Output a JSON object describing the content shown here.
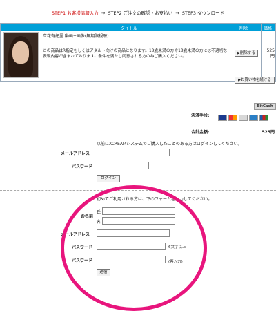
{
  "steps": {
    "step1": "STEP1 お客様情報入力",
    "arrow": "→",
    "step2": "STEP2 ご注文の確認・お支払い",
    "step3": "STEP3 ダウンロード"
  },
  "cart": {
    "col_title": "タイトル",
    "col_delete": "削除",
    "col_price": "価格",
    "item_title": "立花有紀里 動画+画像(無期限視聴)",
    "item_notice": "この商品はR指定もしくはアダルト向けの商品となります。18歳未満の方や18歳未満の方には不適切な表現内容が含まれております。条件を満たし同意される方のみご購入ください。",
    "delete_label": "削除する",
    "price": "525",
    "price_unit": "円",
    "continue_label": "お買い物を続ける"
  },
  "payment": {
    "bitcash_label": "BitCash",
    "method_label": "決済手段:",
    "cards": [
      "VISA",
      "MasterCard",
      "DC",
      "AMEX",
      "JCB"
    ],
    "total_label": "合計金額:",
    "total_value": "525円"
  },
  "login": {
    "note": "以前にXCREAMシステムでご購入したことのある方はログインしてください。",
    "email_label": "メールアドレス",
    "password_label": "パスワード",
    "login_label": "ログイン"
  },
  "register": {
    "note": "初めてご利用される方は、下のフォームを入力してください。",
    "name_label": "お名前",
    "last_label": "氏",
    "first_label": "名",
    "email_label": "メールアドレス",
    "password_label": "パスワード",
    "password_hint": "6文字以上",
    "password_confirm_label": "パスワード",
    "password_confirm_hint": "(再入力)",
    "submit_label": "送信"
  },
  "colors": {
    "accent": "#00a0d8",
    "step_active": "#cc0000",
    "highlight": "#e8157d"
  }
}
